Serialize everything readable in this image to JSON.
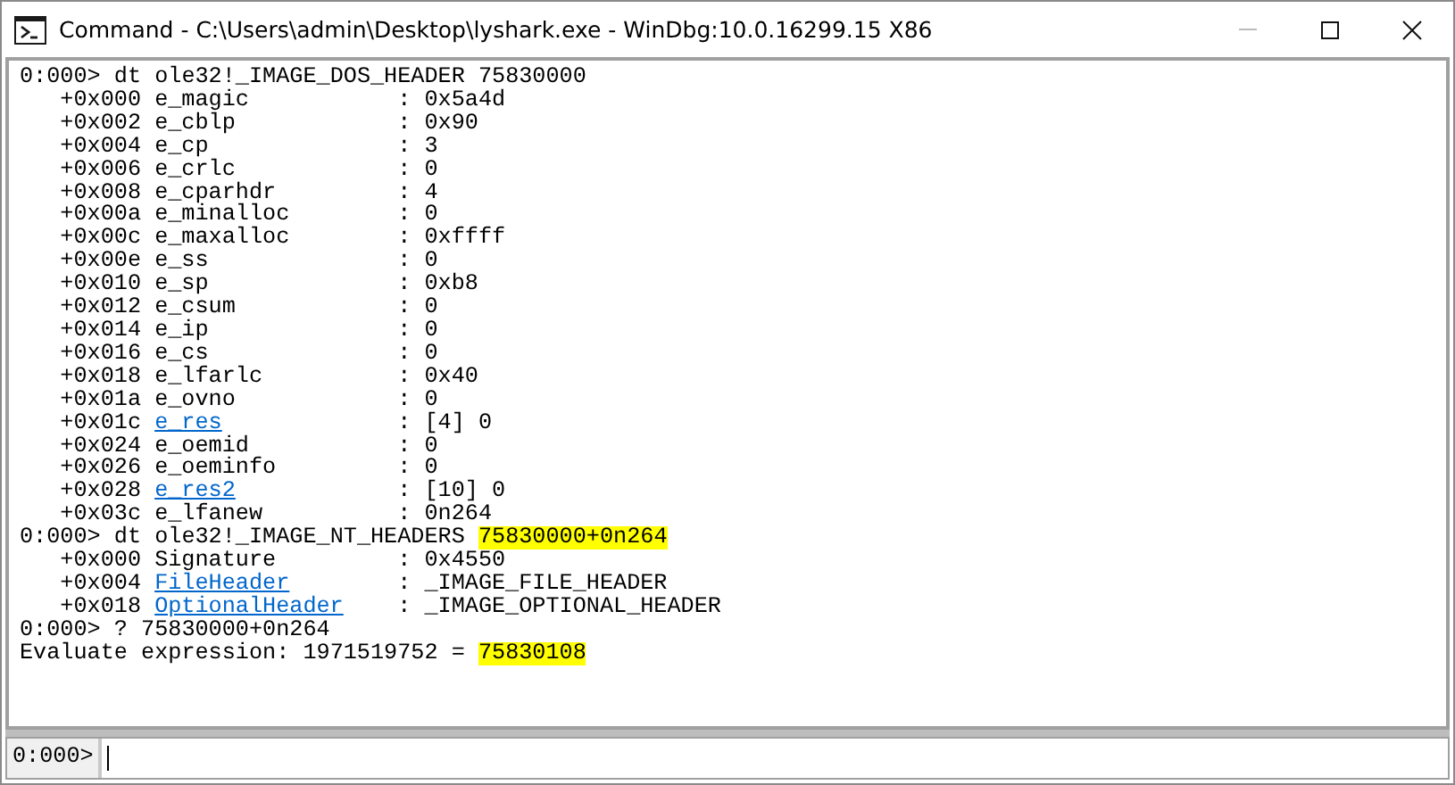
{
  "window": {
    "title": "Command - C:\\Users\\admin\\Desktop\\lyshark.exe - WinDbg:10.0.16299.15 X86"
  },
  "output": [
    {
      "kind": "command",
      "prompt": "0:000>",
      "text": "dt ole32!_IMAGE_DOS_HEADER",
      "argument": {
        "text": "75830000",
        "highlighted": false
      }
    },
    {
      "kind": "field",
      "offset": "+0x000",
      "name": "e_magic",
      "link": false,
      "value": ": 0x5a4d"
    },
    {
      "kind": "field",
      "offset": "+0x002",
      "name": "e_cblp",
      "link": false,
      "value": ": 0x90"
    },
    {
      "kind": "field",
      "offset": "+0x004",
      "name": "e_cp",
      "link": false,
      "value": ": 3"
    },
    {
      "kind": "field",
      "offset": "+0x006",
      "name": "e_crlc",
      "link": false,
      "value": ": 0"
    },
    {
      "kind": "field",
      "offset": "+0x008",
      "name": "e_cparhdr",
      "link": false,
      "value": ": 4"
    },
    {
      "kind": "field",
      "offset": "+0x00a",
      "name": "e_minalloc",
      "link": false,
      "value": ": 0"
    },
    {
      "kind": "field",
      "offset": "+0x00c",
      "name": "e_maxalloc",
      "link": false,
      "value": ": 0xffff"
    },
    {
      "kind": "field",
      "offset": "+0x00e",
      "name": "e_ss",
      "link": false,
      "value": ": 0"
    },
    {
      "kind": "field",
      "offset": "+0x010",
      "name": "e_sp",
      "link": false,
      "value": ": 0xb8"
    },
    {
      "kind": "field",
      "offset": "+0x012",
      "name": "e_csum",
      "link": false,
      "value": ": 0"
    },
    {
      "kind": "field",
      "offset": "+0x014",
      "name": "e_ip",
      "link": false,
      "value": ": 0"
    },
    {
      "kind": "field",
      "offset": "+0x016",
      "name": "e_cs",
      "link": false,
      "value": ": 0"
    },
    {
      "kind": "field",
      "offset": "+0x018",
      "name": "e_lfarlc",
      "link": false,
      "value": ": 0x40"
    },
    {
      "kind": "field",
      "offset": "+0x01a",
      "name": "e_ovno",
      "link": false,
      "value": ": 0"
    },
    {
      "kind": "field",
      "offset": "+0x01c",
      "name": "e_res",
      "link": true,
      "value": ": [4] 0"
    },
    {
      "kind": "field",
      "offset": "+0x024",
      "name": "e_oemid",
      "link": false,
      "value": ": 0"
    },
    {
      "kind": "field",
      "offset": "+0x026",
      "name": "e_oeminfo",
      "link": false,
      "value": ": 0"
    },
    {
      "kind": "field",
      "offset": "+0x028",
      "name": "e_res2",
      "link": true,
      "value": ": [10] 0"
    },
    {
      "kind": "field",
      "offset": "+0x03c",
      "name": "e_lfanew",
      "link": false,
      "value": ": 0n264"
    },
    {
      "kind": "command",
      "prompt": "0:000>",
      "text": "dt ole32!_IMAGE_NT_HEADERS",
      "argument": {
        "text": "75830000+0n264",
        "highlighted": true
      }
    },
    {
      "kind": "field",
      "offset": "+0x000",
      "name": "Signature",
      "link": false,
      "value": ": 0x4550"
    },
    {
      "kind": "field",
      "offset": "+0x004",
      "name": "FileHeader",
      "link": true,
      "value": ": _IMAGE_FILE_HEADER"
    },
    {
      "kind": "field",
      "offset": "+0x018",
      "name": "OptionalHeader",
      "link": true,
      "value": ": _IMAGE_OPTIONAL_HEADER"
    },
    {
      "kind": "command",
      "prompt": "0:000>",
      "text": "?",
      "argument": {
        "text": "75830000+0n264",
        "highlighted": false
      }
    },
    {
      "kind": "result",
      "text": "Evaluate expression: 1971519752 =",
      "argument": {
        "text": "75830108",
        "highlighted": true
      }
    }
  ],
  "command_bar": {
    "prompt": "0:000>"
  }
}
